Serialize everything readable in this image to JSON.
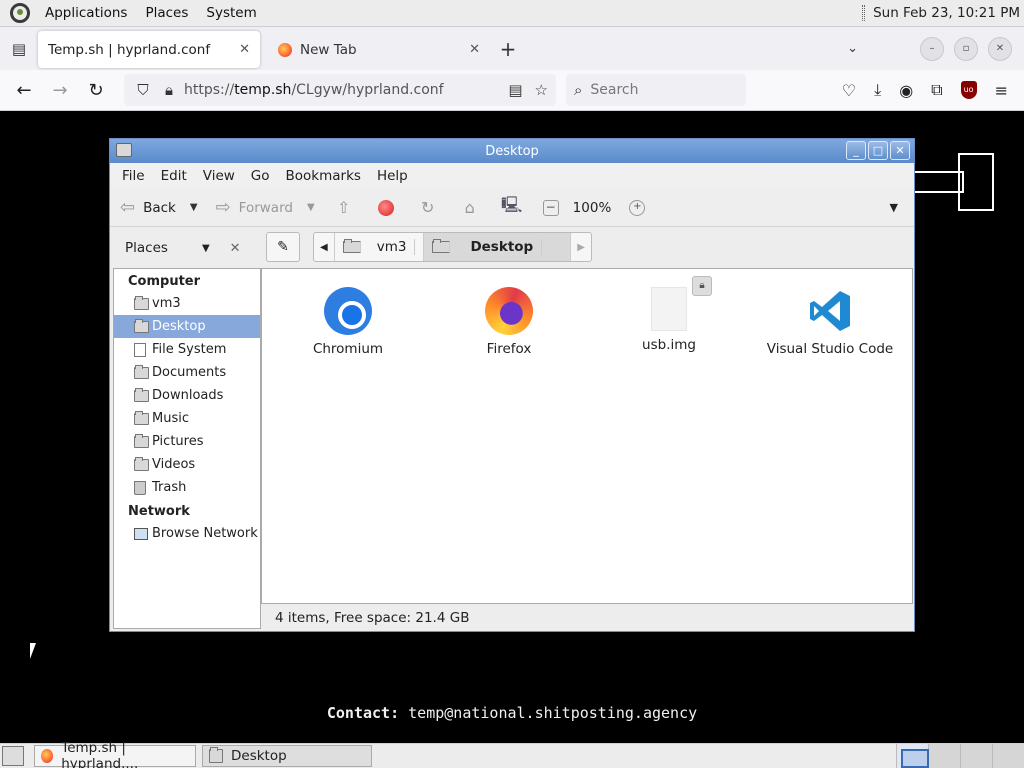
{
  "top_panel": {
    "menus": [
      "Applications",
      "Places",
      "System"
    ],
    "clock": "Sun Feb 23, 10:21 PM"
  },
  "browser": {
    "tabs": [
      {
        "title": "Temp.sh | hyprland.conf",
        "active": true
      },
      {
        "title": "New Tab",
        "active": false
      }
    ],
    "url_prefix": "https://",
    "url_host": "temp.sh",
    "url_path": "/CLgyw/hyprland.conf",
    "search_placeholder": "Search"
  },
  "page": {
    "contact_label": "Contact:",
    "contact_value": "temp@national.shitposting.agency"
  },
  "file_manager": {
    "title": "Desktop",
    "menu": [
      "File",
      "Edit",
      "View",
      "Go",
      "Bookmarks",
      "Help"
    ],
    "toolbar": {
      "back": "Back",
      "forward": "Forward",
      "zoom": "100%"
    },
    "sidebar": {
      "header": "Places",
      "sections": [
        {
          "title": "Computer",
          "items": [
            "vm3",
            "Desktop",
            "File System",
            "Documents",
            "Downloads",
            "Music",
            "Pictures",
            "Videos",
            "Trash"
          ]
        },
        {
          "title": "Network",
          "items": [
            "Browse Network"
          ]
        }
      ],
      "selected": "Desktop"
    },
    "path": [
      "vm3",
      "Desktop"
    ],
    "items": [
      {
        "name": "Chromium",
        "icon": "chromium-icon"
      },
      {
        "name": "Firefox",
        "icon": "firefox-icon"
      },
      {
        "name": "usb.img",
        "icon": "file-icon"
      },
      {
        "name": "Visual Studio Code",
        "icon": "vscode-icon"
      }
    ],
    "status": "4 items, Free space: 21.4 GB"
  },
  "taskbar": {
    "tasks": [
      "Temp.sh | hyprland....",
      "Desktop"
    ]
  }
}
